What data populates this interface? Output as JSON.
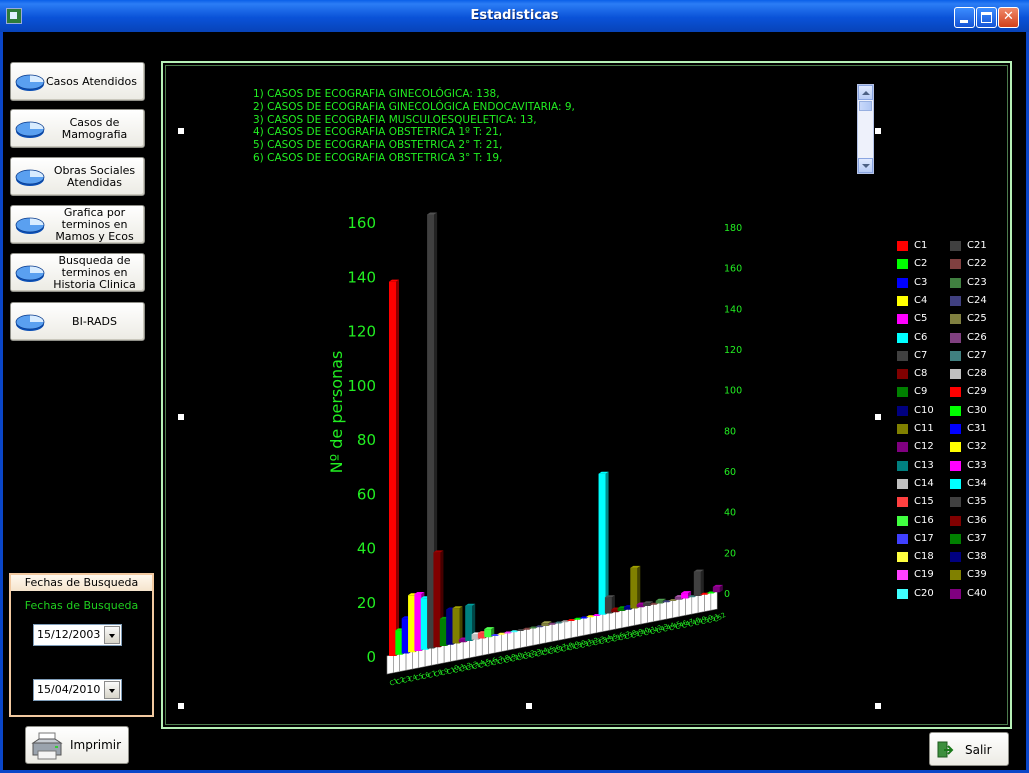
{
  "window": {
    "title": "Estadisticas"
  },
  "sidebar": {
    "buttons": [
      {
        "label": "Casos Atendidos"
      },
      {
        "label": "Casos de Mamografia"
      },
      {
        "label": "Obras Sociales Atendidas"
      },
      {
        "label": "Grafica por terminos en Mamos y Ecos"
      },
      {
        "label": "Busqueda de terminos en Historia Clinica"
      },
      {
        "label": "BI-RADS"
      }
    ]
  },
  "search_dates": {
    "group_title": "Fechas de Busqueda",
    "label": "Fechas de Busqueda",
    "from": "15/12/2003",
    "to": "15/04/2010"
  },
  "footer": {
    "print_label": "Imprimir",
    "exit_label": "Salir"
  },
  "cases_list": [
    "1) CASOS DE ECOGRAFIA  GINECOLÓGICA: 138,",
    "2) CASOS DE ECOGRAFIA  GINECOLÓGICA ENDOCAVITARIA: 9,",
    "3) CASOS DE ECOGRAFIA  MUSCULOESQUELETICA: 13,",
    "4) CASOS DE ECOGRAFIA  OBSTETRICA 1º T: 21,",
    "5) CASOS DE ECOGRAFIA  OBSTETRICA 2° T: 21,",
    "6) CASOS DE ECOGRAFIA  OBSTETRICA 3° T: 19,"
  ],
  "colors": {
    "axis_text": "#22ee22",
    "panel_border": "#b7f0b7",
    "background": "#000000"
  },
  "chart_data": {
    "type": "bar",
    "ylabel": "Nº de personas",
    "ylim": [
      0,
      160
    ],
    "yticks": [
      "0",
      "20",
      "40",
      "60",
      "80",
      "100",
      "120",
      "140",
      "160"
    ],
    "yticks_back": [
      "0",
      "20",
      "40",
      "60",
      "80",
      "100",
      "120",
      "140",
      "160",
      "180"
    ],
    "series": [
      {
        "category": "C1",
        "value": 138,
        "color": "#ff0000"
      },
      {
        "category": "C2",
        "value": 9,
        "color": "#00ff00"
      },
      {
        "category": "C3",
        "value": 13,
        "color": "#0000ff"
      },
      {
        "category": "C4",
        "value": 21,
        "color": "#ffff00"
      },
      {
        "category": "C5",
        "value": 21,
        "color": "#ff00ff"
      },
      {
        "category": "C6",
        "value": 19,
        "color": "#00ffff"
      },
      {
        "category": "C7",
        "value": 160,
        "color": "#404040"
      },
      {
        "category": "C8",
        "value": 35,
        "color": "#800000"
      },
      {
        "category": "C9",
        "value": 10,
        "color": "#008000"
      },
      {
        "category": "C10",
        "value": 13,
        "color": "#000080"
      },
      {
        "category": "C11",
        "value": 13,
        "color": "#808000"
      },
      {
        "category": "C12",
        "value": 1,
        "color": "#800080"
      },
      {
        "category": "C13",
        "value": 13,
        "color": "#008080"
      },
      {
        "category": "C14",
        "value": 2,
        "color": "#c0c0c0"
      },
      {
        "category": "C15",
        "value": 2,
        "color": "#ff4040"
      },
      {
        "category": "C16",
        "value": 3,
        "color": "#40ff40"
      },
      {
        "category": "C17",
        "value": 0,
        "color": "#4040ff"
      },
      {
        "category": "C18",
        "value": 0,
        "color": "#ffff40"
      },
      {
        "category": "C19",
        "value": 0,
        "color": "#ff40ff"
      },
      {
        "category": "C20",
        "value": 0,
        "color": "#40ffff"
      },
      {
        "category": "C21",
        "value": 0,
        "color": "#404040"
      },
      {
        "category": "C22",
        "value": 0,
        "color": "#804040"
      },
      {
        "category": "C23",
        "value": 0,
        "color": "#408040"
      },
      {
        "category": "C24",
        "value": 0,
        "color": "#404080"
      },
      {
        "category": "C25",
        "value": 1,
        "color": "#808040"
      },
      {
        "category": "C26",
        "value": 0,
        "color": "#804080"
      },
      {
        "category": "C27",
        "value": 0,
        "color": "#408080"
      },
      {
        "category": "C28",
        "value": 0,
        "color": "#a0a0a0"
      },
      {
        "category": "C29",
        "value": 0,
        "color": "#ff0000"
      },
      {
        "category": "C30",
        "value": 0,
        "color": "#00ff00"
      },
      {
        "category": "C31",
        "value": 0,
        "color": "#0000ff"
      },
      {
        "category": "C32",
        "value": 0,
        "color": "#ffff00"
      },
      {
        "category": "C33",
        "value": 0,
        "color": "#ff00ff"
      },
      {
        "category": "C34",
        "value": 52,
        "color": "#00ffff"
      },
      {
        "category": "C35",
        "value": 6,
        "color": "#404040"
      },
      {
        "category": "C36",
        "value": 1,
        "color": "#800000"
      },
      {
        "category": "C37",
        "value": 1,
        "color": "#008000"
      },
      {
        "category": "C38",
        "value": 1,
        "color": "#000080"
      },
      {
        "category": "C39",
        "value": 15,
        "color": "#808000"
      },
      {
        "category": "C40",
        "value": 1,
        "color": "#800080"
      },
      {
        "category": "C41",
        "value": 1,
        "color": "#404040"
      },
      {
        "category": "C42",
        "value": 0,
        "color": "#804040"
      },
      {
        "category": "C43",
        "value": 1,
        "color": "#408040"
      },
      {
        "category": "C44",
        "value": 0,
        "color": "#404080"
      },
      {
        "category": "C45",
        "value": 0,
        "color": "#808040"
      },
      {
        "category": "C46",
        "value": 1,
        "color": "#804080"
      },
      {
        "category": "C47",
        "value": 2,
        "color": "#ff00ff"
      },
      {
        "category": "C48",
        "value": 0,
        "color": "#408080"
      },
      {
        "category": "C49",
        "value": 9,
        "color": "#404040"
      },
      {
        "category": "C50",
        "value": 0,
        "color": "#ff0000"
      },
      {
        "category": "C51",
        "value": 0,
        "color": "#00ff00"
      },
      {
        "category": "C52",
        "value": 2,
        "color": "#800080"
      }
    ],
    "legend": [
      "C1",
      "C2",
      "C3",
      "C4",
      "C5",
      "C6",
      "C7",
      "C8",
      "C9",
      "C10",
      "C11",
      "C12",
      "C13",
      "C14",
      "C15",
      "C16",
      "C17",
      "C18",
      "C19",
      "C20",
      "C21",
      "C22",
      "C23",
      "C24",
      "C25",
      "C26",
      "C27",
      "C28",
      "C29",
      "C30",
      "C31",
      "C32",
      "C33",
      "C34",
      "C35",
      "C36",
      "C37",
      "C38",
      "C39",
      "C40"
    ],
    "legend_colors": [
      "#ff0000",
      "#00ff00",
      "#0000ff",
      "#ffff00",
      "#ff00ff",
      "#00ffff",
      "#404040",
      "#800000",
      "#008000",
      "#000080",
      "#808000",
      "#800080",
      "#008080",
      "#c0c0c0",
      "#ff4040",
      "#40ff40",
      "#4040ff",
      "#ffff40",
      "#ff40ff",
      "#40ffff",
      "#404040",
      "#804040",
      "#408040",
      "#404080",
      "#808040",
      "#804080",
      "#408080",
      "#c0c0c0",
      "#ff0000",
      "#00ff00",
      "#0000ff",
      "#ffff00",
      "#ff00ff",
      "#00ffff",
      "#404040",
      "#800000",
      "#008000",
      "#000080",
      "#808000",
      "#800080"
    ]
  }
}
